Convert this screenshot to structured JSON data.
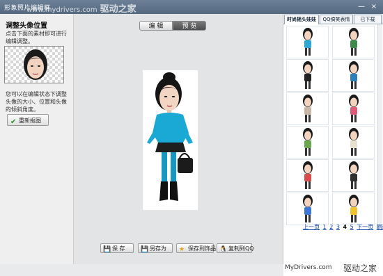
{
  "window": {
    "title": "形象照片编辑框",
    "watermark_small": "www.mydrivers.com",
    "watermark_big": "驱动之家",
    "controls": [
      "—",
      "×"
    ]
  },
  "left_panel": {
    "heading": "调整头像位置",
    "tip_top": "点击下面的素材即可进行编辑调整。",
    "tip_bottom": "您可以在编辑状态下调整头像的大小、位置和头像的倾斜角度。",
    "recrop_label": "重新抠图"
  },
  "center": {
    "tabs": [
      "编 辑",
      "预 览"
    ],
    "active_tab": 1,
    "buttons": [
      {
        "label": "保 存",
        "icon": "save-icon",
        "glyph": "💾"
      },
      {
        "label": "另存为",
        "icon": "save-as-icon",
        "glyph": "💾"
      },
      {
        "label": "保存到饰品",
        "icon": "star-icon",
        "glyph": "★"
      },
      {
        "label": "复制到QQ",
        "icon": "qq-penguin-icon",
        "glyph": "🐧"
      }
    ]
  },
  "right_panel": {
    "tabs": [
      "时尚摇头娃娃",
      "QQ搞笑表情",
      "已下载"
    ],
    "active_tab": 0,
    "pager": {
      "prev": "上一页",
      "pages": [
        "1",
        "2",
        "3",
        "4",
        "5"
      ],
      "current": "4",
      "next": "下一页",
      "refresh": "刷新"
    }
  },
  "footer": {
    "site": "MyDrivers.com",
    "brand": "驱动之家"
  },
  "colors": {
    "title_bar": "#5d7189",
    "active_tab_dark": "#555555",
    "link_blue": "#0b3fa8"
  }
}
